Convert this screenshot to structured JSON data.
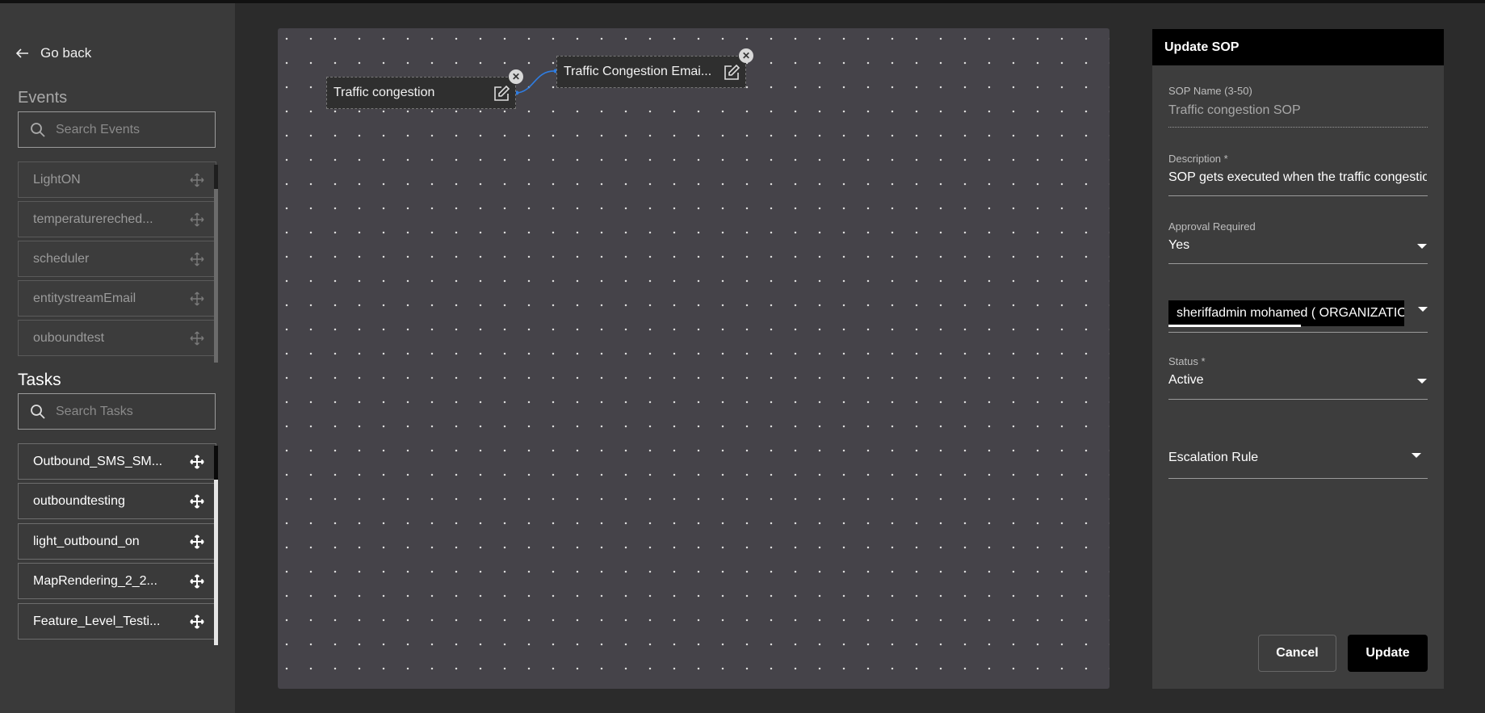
{
  "nav": {
    "go_back": "Go back"
  },
  "events": {
    "title": "Events",
    "search_placeholder": "Search Events",
    "items": [
      "LightON",
      "temperaturereched...",
      "scheduler",
      "entitystreamEmail",
      "ouboundtest"
    ]
  },
  "tasks": {
    "title": "Tasks",
    "search_placeholder": "Search Tasks",
    "items": [
      "Outbound_SMS_SM...",
      "outboundtesting",
      "light_outbound_on",
      "MapRendering_2_2...",
      "Feature_Level_Testi..."
    ]
  },
  "canvas": {
    "nodes": [
      {
        "label": "Traffic congestion"
      },
      {
        "label": "Traffic Congestion Emai..."
      }
    ]
  },
  "panel": {
    "title": "Update SOP",
    "sop_name_label": "SOP Name (3-50)",
    "sop_name_value": "Traffic congestion SOP",
    "description_label": "Description *",
    "description_value": "SOP gets executed when the traffic congestion",
    "approval_label": "Approval Required",
    "approval_value": "Yes",
    "approver_value": "sheriffadmin mohamed ( ORGANIZATION",
    "status_label": "Status *",
    "status_value": "Active",
    "escalation_label": "Escalation Rule",
    "cancel_label": "Cancel",
    "update_label": "Update"
  },
  "colors": {
    "canvas_bg": "#454349",
    "panel_bg": "#3d3d3d",
    "sidebar_bg": "#3a3a3a",
    "connector": "#2f7de1"
  }
}
